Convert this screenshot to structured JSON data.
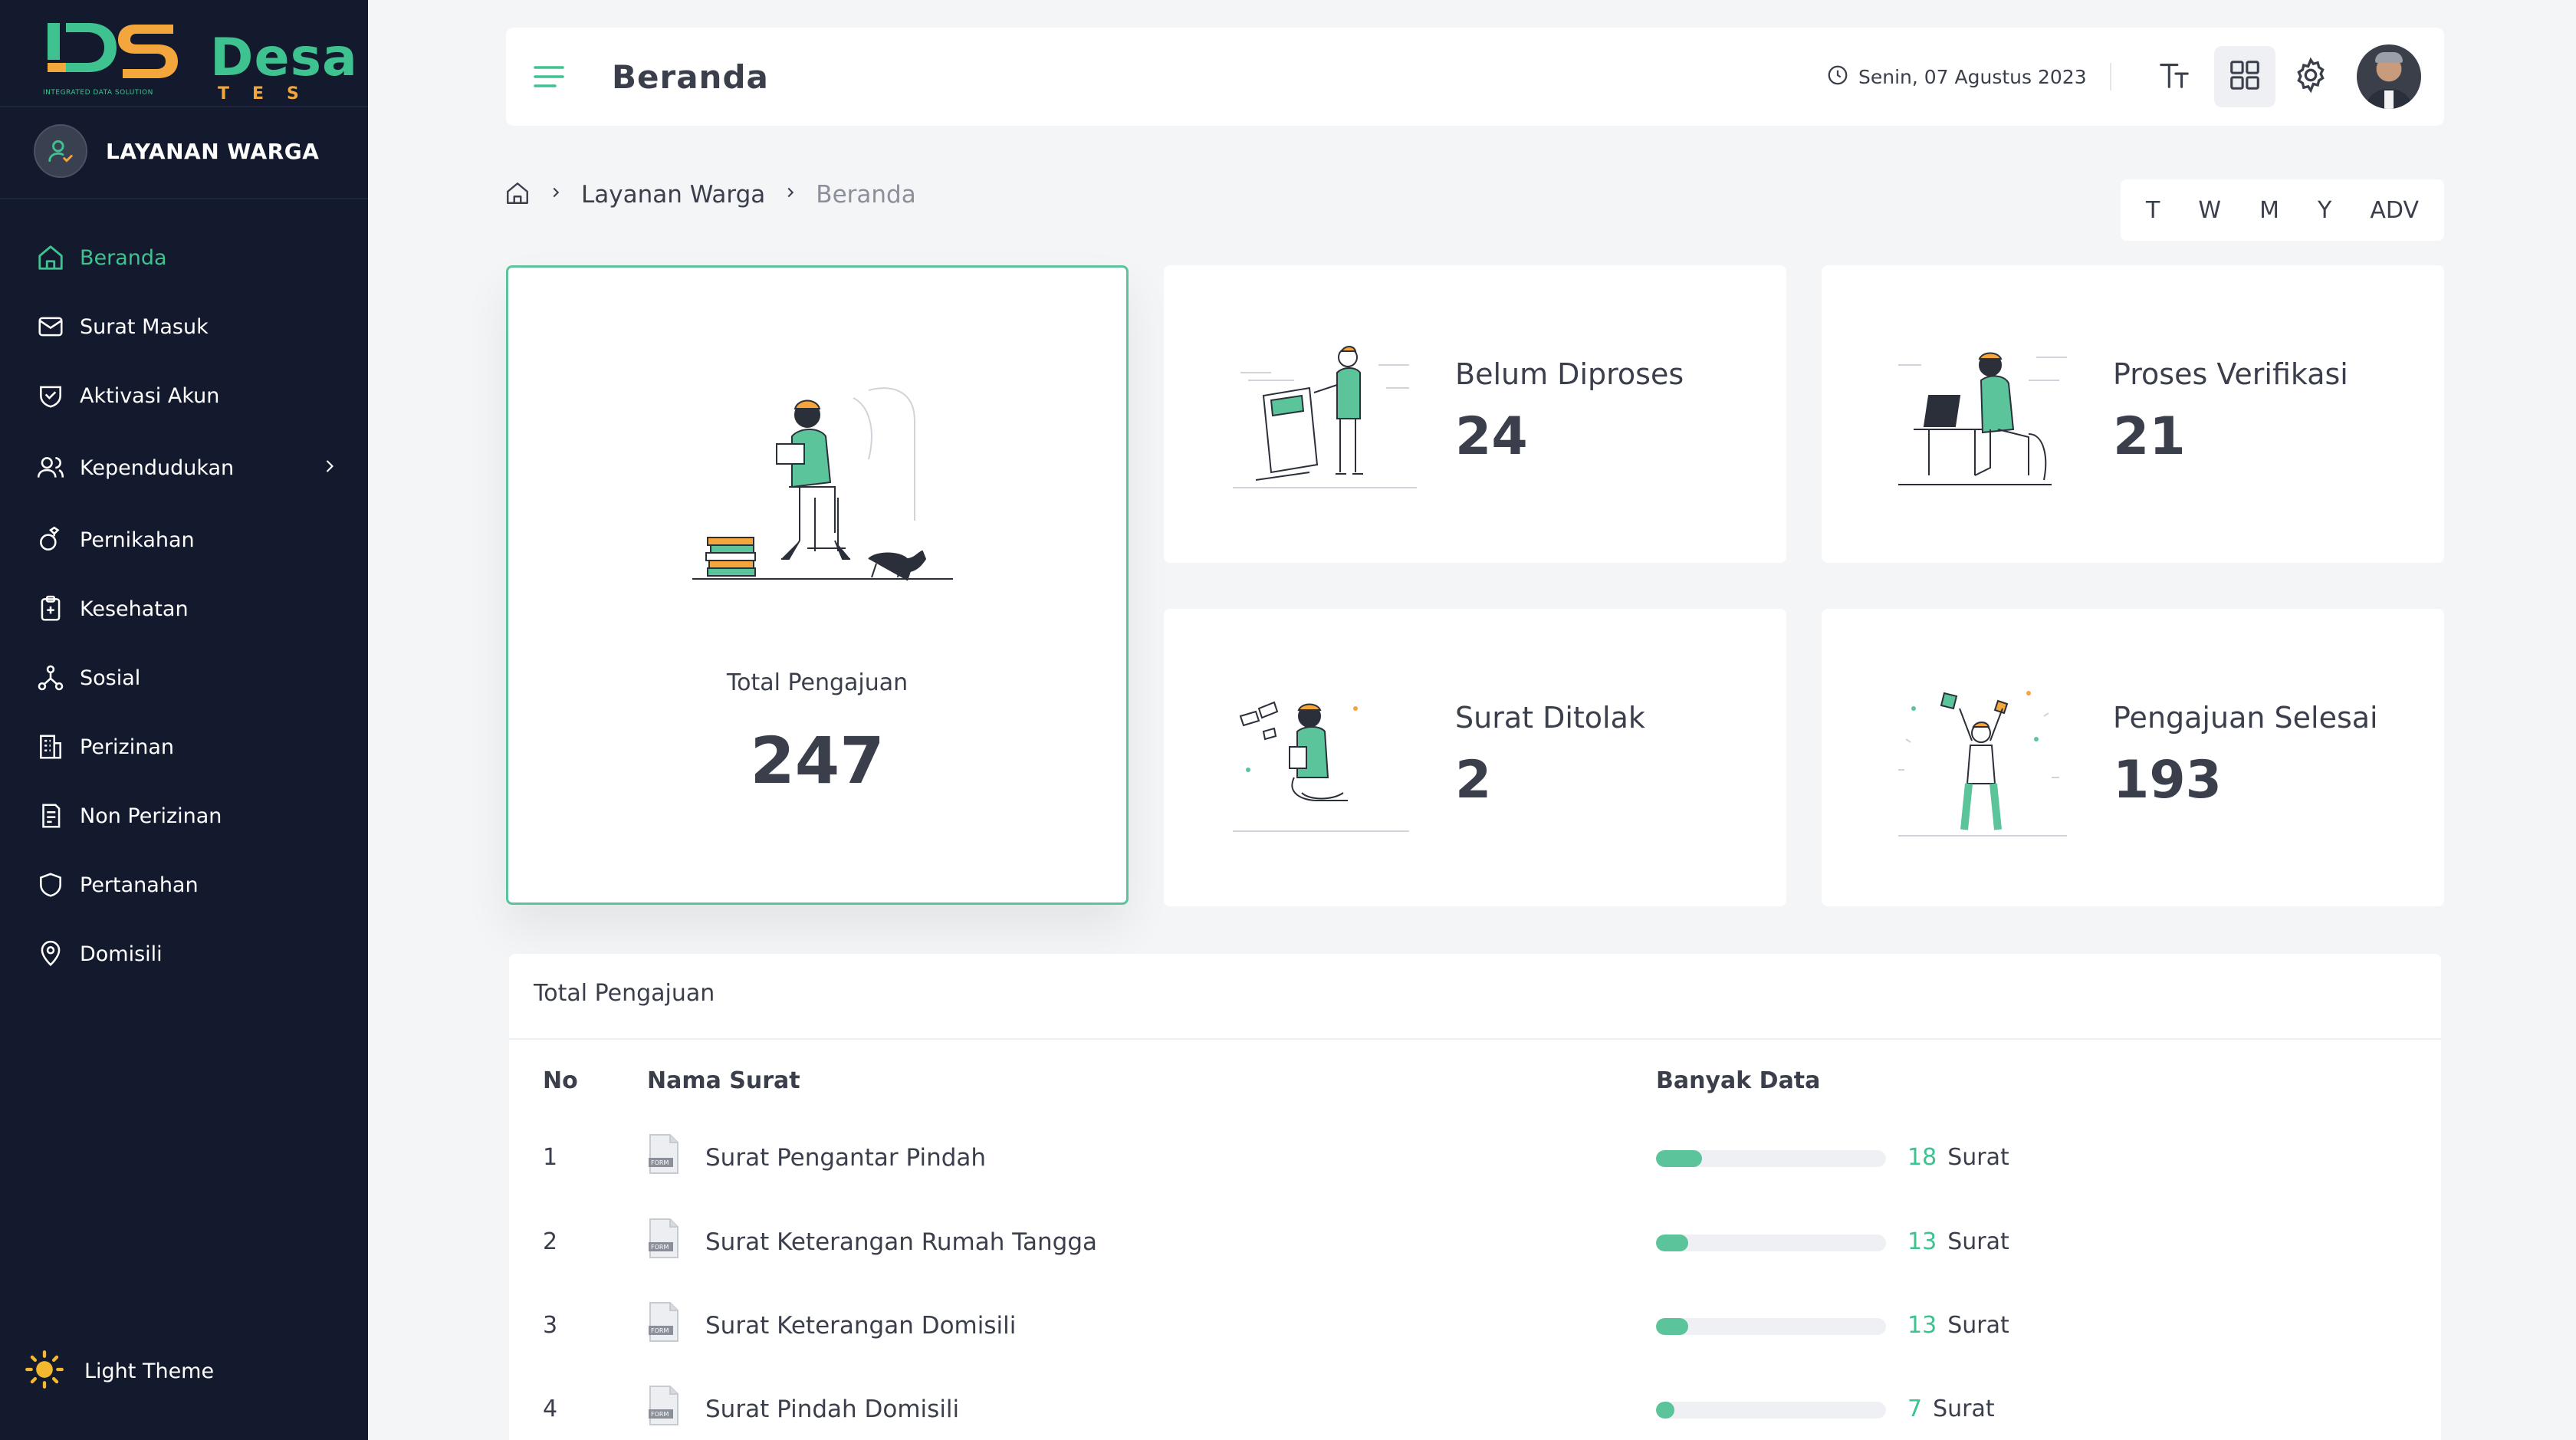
{
  "brand": {
    "logo_icon": "ids-logo-icon",
    "name": "Desa",
    "sub": "TES",
    "tagline": "INTEGRATED DATA SOLUTION",
    "primary_color": "#3ec28f",
    "accent_color": "#f3a63b",
    "sidebar_bg": "#141a2e"
  },
  "sidebar": {
    "user_label": "LAYANAN WARGA",
    "items": [
      {
        "label": "Beranda",
        "icon": "home-icon",
        "active": true
      },
      {
        "label": "Surat Masuk",
        "icon": "mail-icon"
      },
      {
        "label": "Aktivasi Akun",
        "icon": "shield-check-icon"
      },
      {
        "label": "Kependudukan",
        "icon": "users-icon",
        "has_children": true
      },
      {
        "label": "Pernikahan",
        "icon": "rings-icon"
      },
      {
        "label": "Kesehatan",
        "icon": "clipboard-medical-icon"
      },
      {
        "label": "Sosial",
        "icon": "network-icon"
      },
      {
        "label": "Perizinan",
        "icon": "building-icon"
      },
      {
        "label": "Non Perizinan",
        "icon": "document-icon"
      },
      {
        "label": "Pertanahan",
        "icon": "shield-icon"
      },
      {
        "label": "Domisili",
        "icon": "location-pin-icon"
      }
    ],
    "theme_label": "Light Theme",
    "theme_icon": "sun-icon"
  },
  "topbar": {
    "title": "Beranda",
    "date": "Senin, 07 Agustus 2023",
    "icons": [
      "menu-icon",
      "clock-icon",
      "text-size-icon",
      "grid-icon",
      "gear-icon",
      "avatar"
    ]
  },
  "breadcrumb": {
    "items": [
      "Layanan Warga",
      "Beranda"
    ]
  },
  "period": {
    "options": [
      "T",
      "W",
      "M",
      "Y",
      "ADV"
    ]
  },
  "stats": {
    "total": {
      "label": "Total Pengajuan",
      "value": "247"
    },
    "belum": {
      "label": "Belum Diproses",
      "value": "24"
    },
    "verifikasi": {
      "label": "Proses Verifikasi",
      "value": "21"
    },
    "ditolak": {
      "label": "Surat Ditolak",
      "value": "2"
    },
    "selesai": {
      "label": "Pengajuan Selesai",
      "value": "193"
    }
  },
  "table": {
    "title": "Total Pengajuan",
    "headers": {
      "no": "No",
      "nama": "Nama Surat",
      "banyak": "Banyak Data"
    },
    "unit_label": "Surat",
    "rows": [
      {
        "no": "1",
        "name": "Surat Pengantar Pindah",
        "count": "18",
        "fraction": 0.2
      },
      {
        "no": "2",
        "name": "Surat Keterangan Rumah Tangga",
        "count": "13",
        "fraction": 0.14
      },
      {
        "no": "3",
        "name": "Surat Keterangan Domisili",
        "count": "13",
        "fraction": 0.14
      },
      {
        "no": "4",
        "name": "Surat Pindah Domisili",
        "count": "7",
        "fraction": 0.08
      }
    ]
  }
}
